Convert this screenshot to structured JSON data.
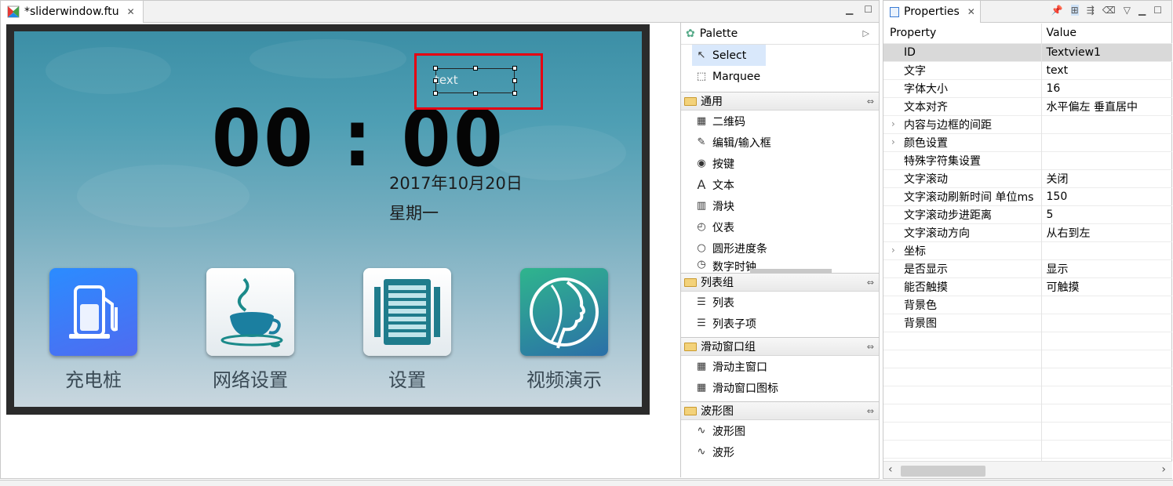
{
  "editor": {
    "tab_title": "*sliderwindow.ftu",
    "clock": "00 : 00",
    "date": "2017年10月20日",
    "weekday": "星期一",
    "textview_text": "text",
    "apps": [
      {
        "label": "充电桩"
      },
      {
        "label": "网络设置"
      },
      {
        "label": "设置"
      },
      {
        "label": "视频演示"
      }
    ]
  },
  "palette": {
    "title": "Palette",
    "tools": [
      {
        "label": "Select",
        "icon": "cursor-icon"
      },
      {
        "label": "Marquee",
        "icon": "marquee-icon"
      }
    ],
    "drawers": [
      {
        "label": "通用",
        "items": [
          "二维码",
          "编辑/输入框",
          "按键",
          "文本",
          "滑块",
          "仪表",
          "圆形进度条",
          "数字时钟"
        ]
      },
      {
        "label": "列表组",
        "items": [
          "列表",
          "列表子项"
        ]
      },
      {
        "label": "滑动窗口组",
        "items": [
          "滑动主窗口",
          "滑动窗口图标"
        ]
      },
      {
        "label": "波形图",
        "items": [
          "波形图",
          "波形"
        ]
      }
    ]
  },
  "properties": {
    "tab_title": "Properties",
    "col_property": "Property",
    "col_value": "Value",
    "rows": [
      {
        "name": "ID",
        "value": "Textview1",
        "selected": true
      },
      {
        "name": "文字",
        "value": "text"
      },
      {
        "name": "字体大小",
        "value": "16"
      },
      {
        "name": "文本对齐",
        "value": "水平偏左  垂直居中"
      },
      {
        "name": "内容与边框的间距",
        "value": "",
        "expandable": true
      },
      {
        "name": "颜色设置",
        "value": "",
        "expandable": true
      },
      {
        "name": "特殊字符集设置",
        "value": ""
      },
      {
        "name": "文字滚动",
        "value": "关闭"
      },
      {
        "name": "文字滚动刷新时间  单位ms",
        "value": "150"
      },
      {
        "name": "文字滚动步进距离",
        "value": "5"
      },
      {
        "name": "文字滚动方向",
        "value": "从右到左"
      },
      {
        "name": "坐标",
        "value": "",
        "expandable": true
      },
      {
        "name": "是否显示",
        "value": "显示"
      },
      {
        "name": "能否触摸",
        "value": "可触摸"
      },
      {
        "name": "背景色",
        "value": ""
      },
      {
        "name": "背景图",
        "value": ""
      }
    ]
  }
}
